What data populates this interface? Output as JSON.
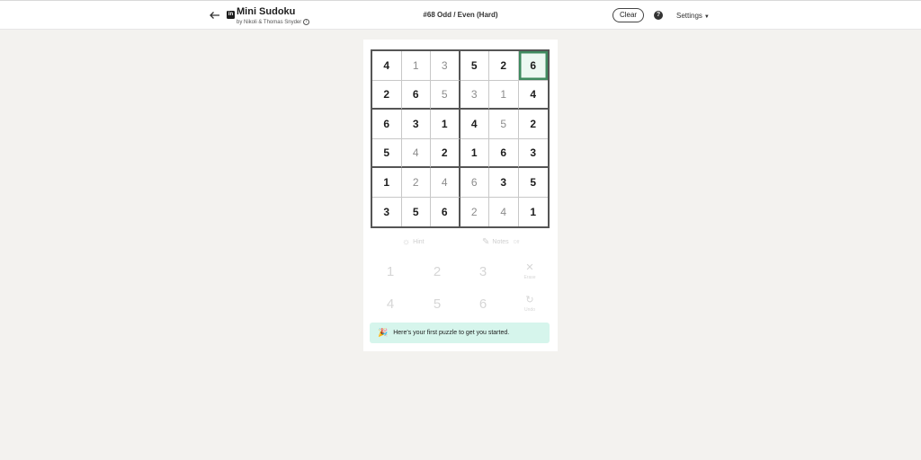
{
  "header": {
    "app_title": "Mini Sudoku",
    "byline": "by Nikoli & Thomas Snyder",
    "puzzle_title": "#68 Odd / Even (Hard)",
    "clear_label": "Clear",
    "settings_label": "Settings",
    "icons": {
      "back": "back-arrow-icon",
      "brand": "linkedin-icon",
      "info": "info-icon",
      "help": "help-icon",
      "caret": "chevron-down-icon"
    }
  },
  "board": {
    "size": 6,
    "selected": [
      0,
      5
    ],
    "cells": [
      [
        {
          "v": "4",
          "given": true
        },
        {
          "v": "1",
          "given": false
        },
        {
          "v": "3",
          "given": false
        },
        {
          "v": "5",
          "given": true
        },
        {
          "v": "2",
          "given": true
        },
        {
          "v": "6",
          "given": true
        }
      ],
      [
        {
          "v": "2",
          "given": true
        },
        {
          "v": "6",
          "given": true
        },
        {
          "v": "5",
          "given": false
        },
        {
          "v": "3",
          "given": false
        },
        {
          "v": "1",
          "given": false
        },
        {
          "v": "4",
          "given": true
        }
      ],
      [
        {
          "v": "6",
          "given": true
        },
        {
          "v": "3",
          "given": true
        },
        {
          "v": "1",
          "given": true
        },
        {
          "v": "4",
          "given": true
        },
        {
          "v": "5",
          "given": false
        },
        {
          "v": "2",
          "given": true
        }
      ],
      [
        {
          "v": "5",
          "given": true
        },
        {
          "v": "4",
          "given": false
        },
        {
          "v": "2",
          "given": true
        },
        {
          "v": "1",
          "given": true
        },
        {
          "v": "6",
          "given": true
        },
        {
          "v": "3",
          "given": true
        }
      ],
      [
        {
          "v": "1",
          "given": true
        },
        {
          "v": "2",
          "given": false
        },
        {
          "v": "4",
          "given": false
        },
        {
          "v": "6",
          "given": false
        },
        {
          "v": "3",
          "given": true
        },
        {
          "v": "5",
          "given": true
        }
      ],
      [
        {
          "v": "3",
          "given": true
        },
        {
          "v": "5",
          "given": true
        },
        {
          "v": "6",
          "given": true
        },
        {
          "v": "2",
          "given": false
        },
        {
          "v": "4",
          "given": false
        },
        {
          "v": "1",
          "given": true
        }
      ]
    ]
  },
  "tools": {
    "hint_label": "Hint",
    "notes_label": "Notes",
    "notes_state": "Off"
  },
  "keypad": {
    "row1": [
      "1",
      "2",
      "3"
    ],
    "row2": [
      "4",
      "5",
      "6"
    ],
    "erase_label": "Erase",
    "undo_label": "Undo"
  },
  "toast": {
    "text": "Here's your first puzzle to get you started."
  },
  "colors": {
    "page_bg": "#f3f2ef",
    "selected_border": "#3f8a5f",
    "selected_fill": "#edf8f2",
    "toast_bg": "#d6f5ec"
  }
}
